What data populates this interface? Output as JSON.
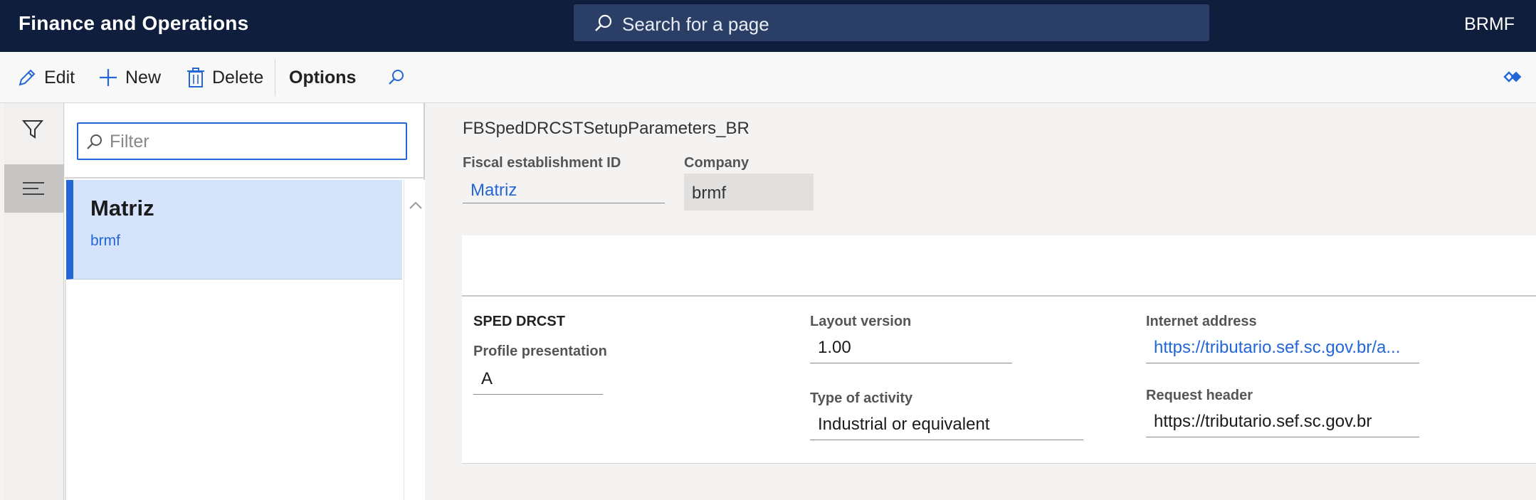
{
  "topbar": {
    "app_title": "Finance and Operations",
    "search_placeholder": "Search for a page",
    "company": "BRMF"
  },
  "actions": {
    "edit": "Edit",
    "new": "New",
    "delete": "Delete",
    "options": "Options"
  },
  "list": {
    "filter_placeholder": "Filter",
    "items": [
      {
        "title": "Matriz",
        "subtitle": "brmf"
      }
    ]
  },
  "details": {
    "caption": "FBSpedDRCSTSetupParameters_BR",
    "fiscal_establishment_label": "Fiscal establishment ID",
    "fiscal_establishment_value": "Matriz",
    "company_label": "Company",
    "company_value": "brmf",
    "section_title": "SPED DRCST",
    "profile_label": "Profile presentation",
    "profile_value": "A",
    "layout_label": "Layout version",
    "layout_value": "1.00",
    "activity_label": "Type of activity",
    "activity_value": "Industrial or equivalent",
    "internet_label": "Internet address",
    "internet_value": "https://tributario.sef.sc.gov.br/a...",
    "request_label": "Request header",
    "request_value": "https://tributario.sef.sc.gov.br"
  },
  "colors": {
    "navbar": "#0f1e3d",
    "accent": "#2266d8",
    "selected_row": "#d6e4fb"
  },
  "icons": [
    "search-icon",
    "edit-icon",
    "plus-icon",
    "delete-icon",
    "find-icon",
    "expand-icon",
    "filter-icon",
    "list-icon",
    "chevron-up-icon"
  ]
}
